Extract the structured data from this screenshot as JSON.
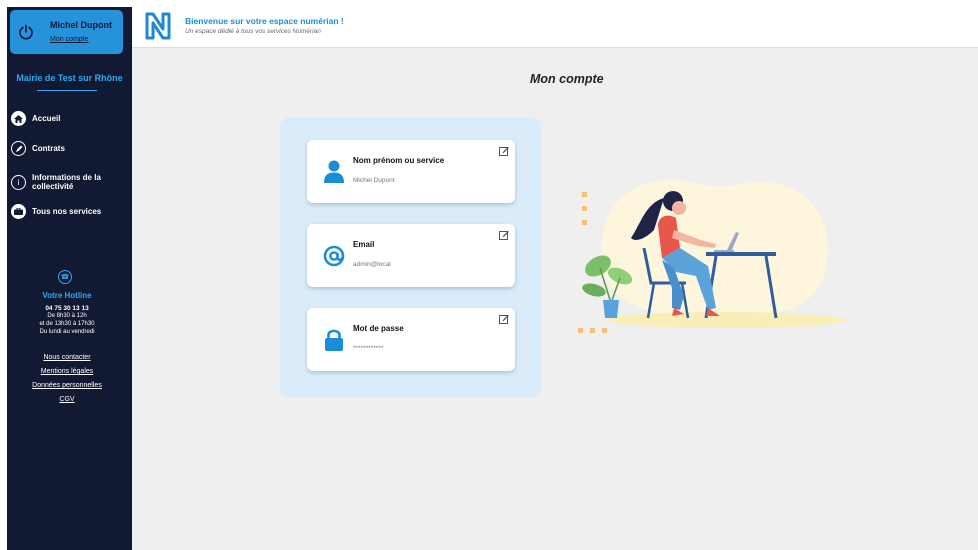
{
  "sidebar": {
    "user_name": "Michel Dupont",
    "user_account_link": "Mon compte",
    "organization": "Mairie de Test sur Rhône",
    "nav": [
      {
        "label": "Accueil",
        "icon": "home-icon"
      },
      {
        "label": "Contrats",
        "icon": "pen-icon"
      },
      {
        "label": "Informations de la collectivité",
        "icon": "info-icon"
      },
      {
        "label": "Tous nos services",
        "icon": "services-icon"
      }
    ],
    "hotline": {
      "title": "Votre Hotline",
      "phone": "04 75 30 13 13",
      "hours_1": "De 8h30 à 12h",
      "hours_2": "et de 13h30 à 17h30",
      "days": "Du lundi au vendredi"
    },
    "footer_links": [
      "Nous contacter",
      "Mentions légales",
      "Données personnelles",
      "CGV"
    ]
  },
  "header": {
    "welcome": "Bienvenue sur votre espace numérian !",
    "tagline": "Un espace dédié à tous vos services Numérian"
  },
  "main": {
    "title": "Mon compte",
    "cards": [
      {
        "title": "Nom prénom ou service",
        "value": "Michel Dupont",
        "icon": "user-icon"
      },
      {
        "title": "Email",
        "value": "admin@local",
        "icon": "at-icon"
      },
      {
        "title": "Mot de passe",
        "value": "************",
        "icon": "lock-icon"
      }
    ]
  },
  "colors": {
    "sidebar_bg": "#121a33",
    "accent": "#2592da",
    "panel_bg": "#daecf9"
  }
}
